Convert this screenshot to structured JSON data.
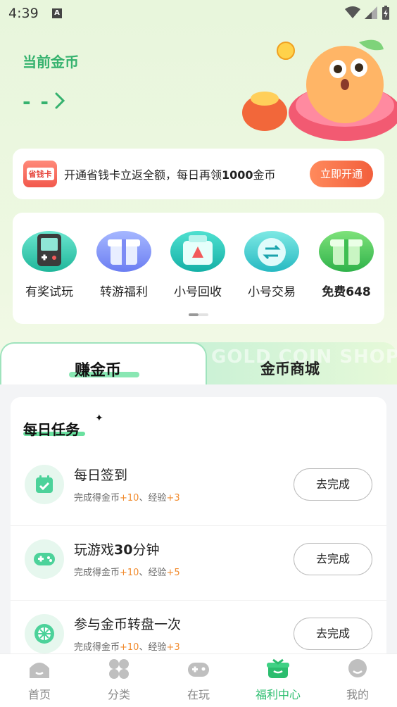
{
  "status": {
    "time": "4:39",
    "notif_glyph": "A"
  },
  "header": {
    "coin_label": "当前金币",
    "coin_value": "- -"
  },
  "banner": {
    "card_label": "省钱卡",
    "text_prefix": "开通省钱卡立返全额，每日再领",
    "text_amount": "1000",
    "text_suffix": "金币",
    "button": "立即开通"
  },
  "shortcuts": [
    {
      "label": "有奖试玩",
      "icon": "gameboy-icon"
    },
    {
      "label": "转游福利",
      "icon": "gift-box-icon"
    },
    {
      "label": "小号回收",
      "icon": "recycle-box-icon"
    },
    {
      "label": "小号交易",
      "icon": "exchange-icon"
    },
    {
      "label": "免费648",
      "icon": "green-gift-icon"
    }
  ],
  "tabs": {
    "earn": "赚金币",
    "shop": "金币商城",
    "shop_ghost": "GOLD COIN SHOP"
  },
  "daily": {
    "title": "每日任务",
    "tasks": [
      {
        "name": "每日签到",
        "sub_prefix": "完成得金币",
        "coins": "+10",
        "sep": "、经验",
        "exp": "+3",
        "button": "去完成",
        "icon": "calendar-check-icon"
      },
      {
        "name_prefix": "玩游戏",
        "name_bold": "30",
        "name_suffix": "分钟",
        "sub_prefix": "完成得金币",
        "coins": "+10",
        "sep": "、经验",
        "exp": "+5",
        "button": "去完成",
        "icon": "gamepad-icon"
      },
      {
        "name": "参与金币转盘一次",
        "sub_prefix": "完成得金币",
        "coins": "+10",
        "sep": "、经验",
        "exp": "+3",
        "button": "去完成",
        "icon": "wheel-icon"
      }
    ]
  },
  "nav": [
    {
      "label": "首页",
      "icon": "home-icon"
    },
    {
      "label": "分类",
      "icon": "category-icon"
    },
    {
      "label": "在玩",
      "icon": "controller-icon"
    },
    {
      "label": "福利中心",
      "icon": "welfare-icon"
    },
    {
      "label": "我的",
      "icon": "profile-icon"
    }
  ],
  "colors": {
    "accent": "#35b26e",
    "orange": "#f25f3c",
    "coin_orange": "#f18a2c"
  }
}
